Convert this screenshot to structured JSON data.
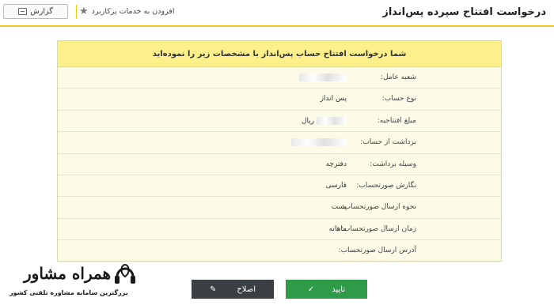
{
  "header": {
    "title": "درخواست افتتاح سپرده پس‌انداز",
    "favorite_label": "افزودن به خدمات پرکاربرد",
    "report_label": "گزارش"
  },
  "panel": {
    "heading": "شما درخواست افتتاح حساب پس‌انداز با مشخصات زیر را نموده‌اید",
    "rows": [
      {
        "label": "شعبه عامل:",
        "value": ""
      },
      {
        "label": "نوع حساب:",
        "value": "پس انداز"
      },
      {
        "label": "مبلغ افتتاحیه:",
        "value": "ریال"
      },
      {
        "label": "برداشت از حساب:",
        "value": ""
      },
      {
        "label": "وسیله برداشت:",
        "value": "دفترچه"
      },
      {
        "label": "نگارش صورتحساب:",
        "value": "فارسی"
      },
      {
        "label": "نحوه ارسال صورتحساب:",
        "value": "پست"
      },
      {
        "label": "زمان ارسال صورتحساب:",
        "value": "ماهانه"
      },
      {
        "label": "آدرس ارسال صورتحساب:",
        "value": ""
      }
    ]
  },
  "actions": {
    "confirm_label": "تایید",
    "edit_label": "اصلاح"
  },
  "watermark": {
    "brand": "همراه مشاور",
    "tagline": "بزرگترین سامانه مشاوره تلفنی کشور"
  }
}
